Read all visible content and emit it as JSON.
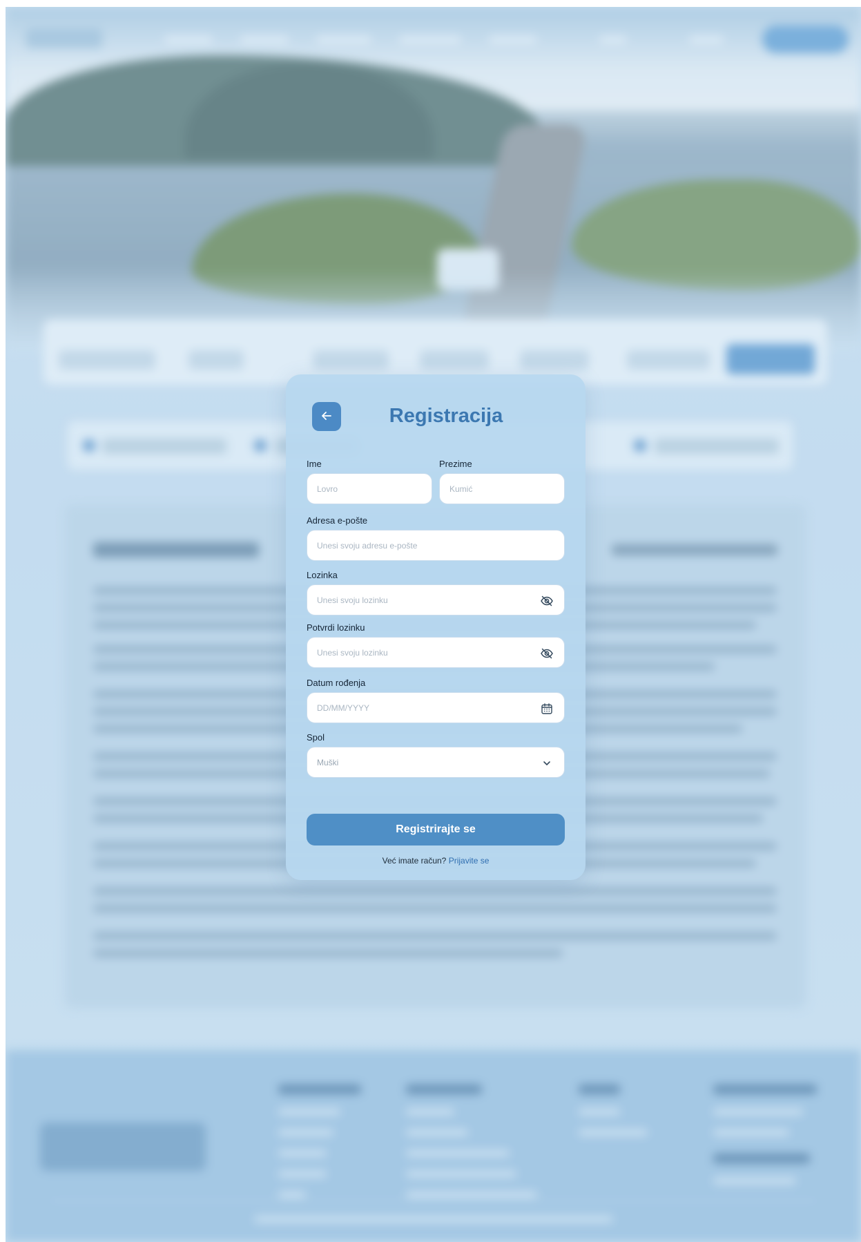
{
  "modal": {
    "title": "Registracija",
    "fields": {
      "first_name": {
        "label": "Ime",
        "placeholder": "Lovro"
      },
      "last_name": {
        "label": "Prezime",
        "placeholder": "Kumić"
      },
      "email": {
        "label": "Adresa e-pošte",
        "placeholder": "Unesi svoju adresu e-pošte"
      },
      "password": {
        "label": "Lozinka",
        "placeholder": "Unesi svoju lozinku"
      },
      "confirm_password": {
        "label": "Potvrdi lozinku",
        "placeholder": "Unesi svoju lozinku"
      },
      "birth_date": {
        "label": "Datum rođenja",
        "placeholder": "DD/MM/YYYY"
      },
      "gender": {
        "label": "Spol",
        "value": "Muški"
      }
    },
    "submit_label": "Registrirajte se",
    "login_prompt": "Već imate račun?",
    "login_link": "Prijavite se",
    "icons": {
      "back": "arrow-left-icon",
      "password_toggle": "eye-off-icon",
      "calendar": "calendar-icon",
      "select": "chevron-down-icon"
    }
  },
  "colors": {
    "accent": "#4f8fc6",
    "title": "#3c78b1",
    "modal_bg": "#b7d7ef"
  }
}
